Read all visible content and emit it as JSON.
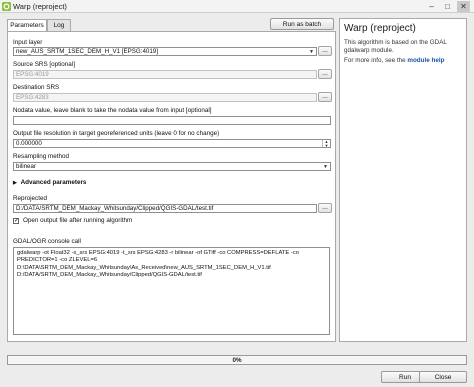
{
  "window": {
    "title": "Warp (reproject)",
    "min": "–",
    "max": "□",
    "close": "✕"
  },
  "tabs": [
    {
      "label": "Parameters"
    },
    {
      "label": "Log"
    }
  ],
  "batch_button": "Run as batch process...",
  "form": {
    "input_layer": {
      "label": "Input layer",
      "value": "new_AUS_SRTM_1SEC_DEM_H_V1 [EPSG:4019]"
    },
    "source_srs": {
      "label": "Source SRS [optional]",
      "value": "EPSG:4019"
    },
    "dest_srs": {
      "label": "Destination SRS",
      "value": "EPSG:4283"
    },
    "nodata": {
      "label": "Nodata value, leave blank to take the nodata value from input [optional]",
      "value": ""
    },
    "resolution": {
      "label": "Output file resolution in target georeferenced units (leave 0 for no change)",
      "value": "0.000000"
    },
    "resampling": {
      "label": "Resampling method",
      "value": "bilinear"
    },
    "advanced": "Advanced parameters",
    "reprojected": {
      "label": "Reprojected",
      "value": "D:/DATA/SRTM_DEM_Mackay_Whitsunday/Clipped/QGIS-GDAL/test.tif"
    },
    "open_output": {
      "label": "Open output file after running algorithm",
      "checked": true
    },
    "console": {
      "label": "GDAL/OGR console call",
      "text": "gdalwarp -ot Float32 -s_srs EPSG:4019 -t_srs EPSG:4283 -r bilinear -of GTiff -co COMPRESS=DEFLATE -co PREDICTOR=1 -co ZLEVEL=6 D:\\DATA\\SRTM_DEM_Mackay_Whitsunday\\As_Received\\new_AUS_SRTM_1SEC_DEM_H_V1.tif D:/DATA/SRTM_DEM_Mackay_Whitsunday/Clipped/QGIS-GDAL/test.tif"
    },
    "dots": "..."
  },
  "help": {
    "title": "Warp (reproject)",
    "body": "This algorithm is based on the GDAL gdalwarp module.",
    "more_prefix": "For more info, see the ",
    "link": "module help"
  },
  "progress": {
    "text": "0%",
    "value": 0
  },
  "footer": {
    "run": "Run",
    "close": "Close"
  }
}
